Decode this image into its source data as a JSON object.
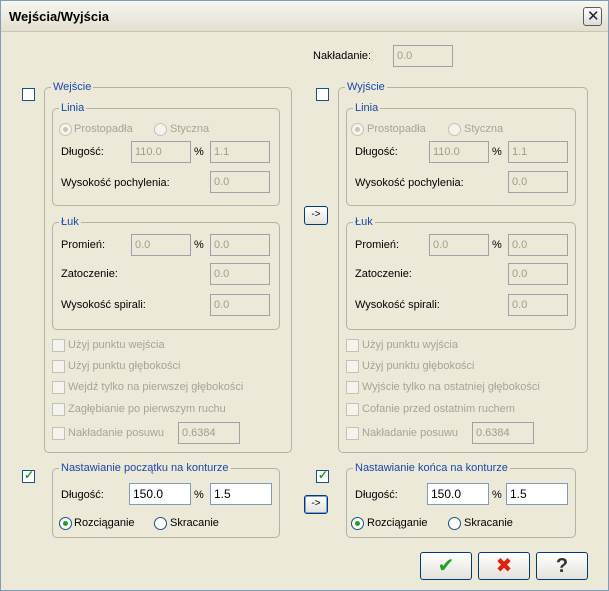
{
  "window": {
    "title": "Wejścia/Wyjścia"
  },
  "overlap": {
    "label": "Nakładanie:",
    "value": "0.0"
  },
  "entry": {
    "title": "Wejście",
    "line": {
      "title": "Linia",
      "radio_perpendicular": "Prostopadła",
      "radio_tangent": "Styczna",
      "length_label": "Długość:",
      "length_value": "110.0",
      "percent_sign": "%",
      "length_pct": "1.1",
      "height_label": "Wysokość pochylenia:",
      "height_value": "0.0"
    },
    "arc": {
      "title": "Łuk",
      "radius_label": "Promień:",
      "radius_value": "0.0",
      "percent_sign": "%",
      "radius_pct": "0.0",
      "sweep_label": "Zatoczenie:",
      "sweep_value": "0.0",
      "spiral_label": "Wysokość spirali:",
      "spiral_value": "0.0"
    },
    "options": [
      "Użyj punktu wejścia",
      "Użyj punktu głębokości",
      "Wejdź tylko na pierwszej głębokości",
      "Zagłębianie po pierwszym ruchu",
      "Nakładanie posuwu"
    ],
    "feed_overlap_value": "0.6384"
  },
  "exit": {
    "title": "Wyjście",
    "line": {
      "title": "Linia",
      "radio_perpendicular": "Prostopadła",
      "radio_tangent": "Styczna",
      "length_label": "Długość:",
      "length_value": "110.0",
      "percent_sign": "%",
      "length_pct": "1.1",
      "height_label": "Wysokość pochylenia:",
      "height_value": "0.0"
    },
    "arc": {
      "title": "Łuk",
      "radius_label": "Promień:",
      "radius_value": "0.0",
      "percent_sign": "%",
      "radius_pct": "0.0",
      "sweep_label": "Zatoczenie:",
      "sweep_value": "0.0",
      "spiral_label": "Wysokość spirali:",
      "spiral_value": "0.0"
    },
    "options": [
      "Użyj punktu wyjścia",
      "Użyj punktu głębokości",
      "Wyjście tylko na ostatniej głębokości",
      "Cofanie przed ostatnim ruchem",
      "Nakładanie posuwu"
    ],
    "feed_overlap_value": "0.6384"
  },
  "copy_button_label": "->",
  "start_adjust": {
    "title": "Nastawianie początku na konturze",
    "length_label": "Długość:",
    "length_value": "150.0",
    "percent_sign": "%",
    "length_pct": "1.5",
    "radio_stretch": "Rozciąganie",
    "radio_shrink": "Skracanie"
  },
  "end_adjust": {
    "title": "Nastawianie końca na konturze",
    "length_label": "Długość:",
    "length_value": "150.0",
    "percent_sign": "%",
    "length_pct": "1.5",
    "radio_stretch": "Rozciąganie",
    "radio_shrink": "Skracanie"
  },
  "buttons": {
    "ok": "✔",
    "cancel": "✖",
    "help": "?"
  },
  "colors": {
    "legend": "#1a47a8",
    "check_green": "#21a121",
    "cancel_red": "#e02010"
  }
}
